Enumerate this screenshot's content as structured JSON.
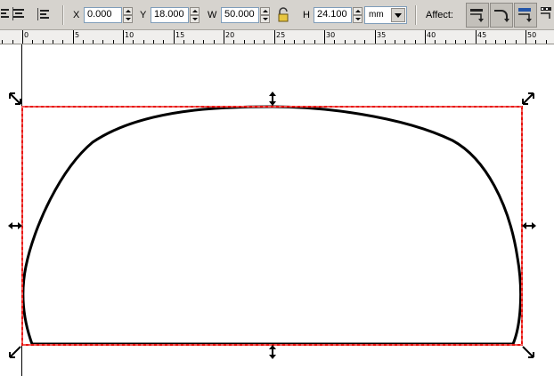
{
  "toolbar": {
    "fields": {
      "x": {
        "label": "X",
        "value": "0.000"
      },
      "y": {
        "label": "Y",
        "value": "18.000"
      },
      "w": {
        "label": "W",
        "value": "50.000"
      },
      "h": {
        "label": "H",
        "value": "24.100"
      }
    },
    "lock_icon": "lock-open-icon",
    "unit": "mm",
    "affect_label": "Affect:",
    "affect_buttons": [
      "scale-stroke-icon",
      "scale-corners-icon",
      "move-gradients-icon",
      "move-patterns-icon"
    ]
  },
  "ruler": {
    "labels": [
      "0",
      "5",
      "10",
      "15",
      "20",
      "25",
      "30",
      "35",
      "40",
      "45",
      "50"
    ]
  },
  "colors": {
    "selection": "#e8100c",
    "shape_stroke": "#000000",
    "toolbar_bg": "#d6d3ce"
  }
}
